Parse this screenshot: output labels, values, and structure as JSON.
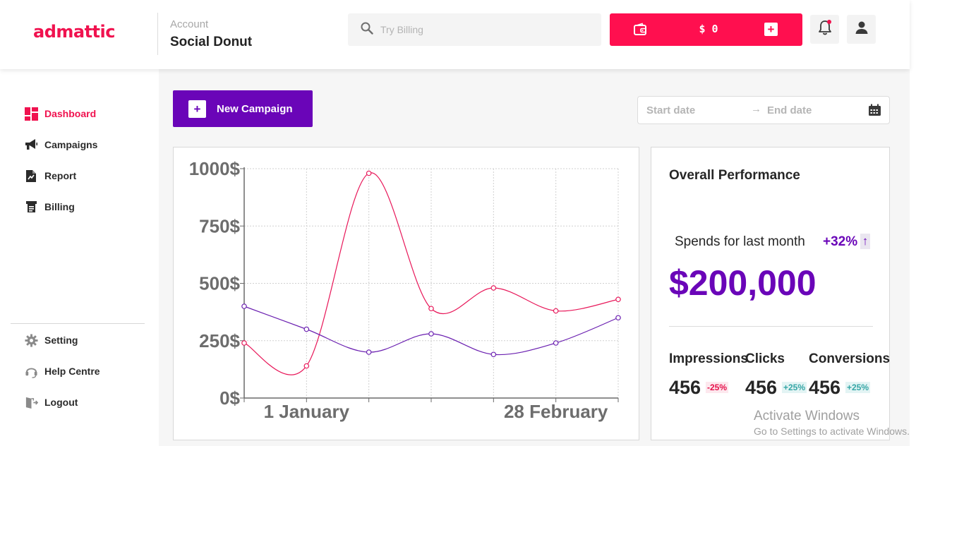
{
  "brand": {
    "logo_text": "admattic",
    "accent": "#f0124f",
    "purple": "#6a05b8"
  },
  "header": {
    "account_label": "Account",
    "account_name": "Social Donut",
    "search": {
      "placeholder": "Try Billing",
      "icon": "search-icon"
    },
    "wallet": {
      "icon": "wallet-icon",
      "amount": "$ 0",
      "add_label": "+"
    },
    "notification_icon": "bell-icon",
    "user_icon": "user-icon"
  },
  "sidebar": {
    "items": [
      {
        "label": "Dashboard",
        "icon": "dashboard-icon",
        "active": true
      },
      {
        "label": "Campaigns",
        "icon": "megaphone-icon",
        "active": false
      },
      {
        "label": "Report",
        "icon": "report-icon",
        "active": false
      },
      {
        "label": "Billing",
        "icon": "billing-icon",
        "active": false
      }
    ],
    "bottom_items": [
      {
        "label": "Setting",
        "icon": "gear-icon"
      },
      {
        "label": "Help Centre",
        "icon": "headset-icon"
      },
      {
        "label": "Logout",
        "icon": "logout-icon"
      }
    ]
  },
  "toolbar": {
    "new_campaign_label": "New Campaign",
    "new_campaign_plus": "+",
    "start_date_placeholder": "Start date",
    "end_date_placeholder": "End date",
    "range_arrow": "→",
    "calendar_icon": "calendar-icon"
  },
  "chart_data": {
    "type": "line",
    "x": [
      0,
      1,
      2,
      3,
      4,
      5,
      6
    ],
    "x_tick_labels": [
      {
        "at": 1,
        "label": "1 January"
      },
      {
        "at": 5,
        "label": "28 February"
      }
    ],
    "y_ticks": [
      0,
      250,
      500,
      750,
      1000
    ],
    "y_tick_labels": [
      "0$",
      "250$",
      "500$",
      "750$",
      "1000$"
    ],
    "ylim": [
      0,
      1000
    ],
    "grid": true,
    "series": [
      {
        "color": "#e8185a",
        "values": [
          240,
          140,
          980,
          390,
          480,
          380,
          430
        ]
      },
      {
        "color": "#6a1fb0",
        "values": [
          400,
          300,
          200,
          280,
          190,
          240,
          350
        ]
      }
    ]
  },
  "performance": {
    "title": "Overall Performance",
    "spend_label": "Spends for last month",
    "spend_change": "+32%",
    "spend_arrow": "↑",
    "spend_value": "$200,000",
    "metrics": [
      {
        "label": "Impressions",
        "value": "456",
        "change": "-25%",
        "trend": "negative"
      },
      {
        "label": "Clicks",
        "value": "456",
        "change": "+25%",
        "trend": "positive"
      },
      {
        "label": "Conversions",
        "value": "456",
        "change": "+25%",
        "trend": "positive"
      }
    ]
  },
  "watermark": {
    "line1": "Activate Windows",
    "line2": "Go to Settings to activate Windows."
  }
}
